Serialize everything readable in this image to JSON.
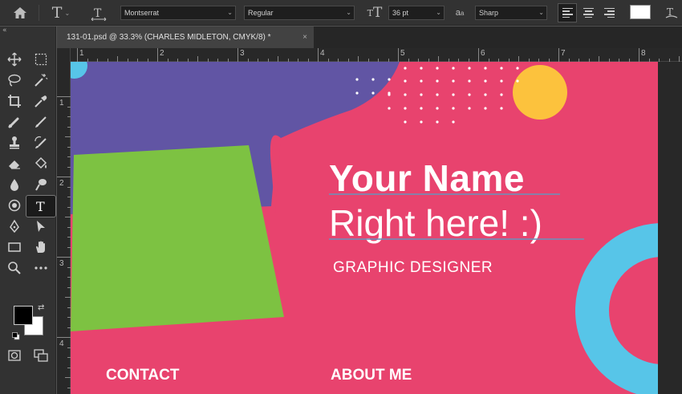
{
  "options_bar": {
    "font_family": "Montserrat",
    "font_style": "Regular",
    "font_size": "36 pt",
    "aa_label": "a",
    "antialias": "Sharp",
    "text_color": "#ffffff"
  },
  "document": {
    "tab_title": "131-01.psd @ 33.3% (CHARLES MIDLETON, CMYK/8) *",
    "close_glyph": "×"
  },
  "ruler": {
    "h_labels": [
      "1",
      "2",
      "3",
      "4",
      "5",
      "6",
      "7",
      "8"
    ],
    "v_labels": [
      "1",
      "2",
      "3",
      "4"
    ]
  },
  "canvas": {
    "name": "Your Name",
    "subtitle": "Right here! :)",
    "role": "GRAPHIC DESIGNER",
    "contact": "CONTACT",
    "about": "ABOUT ME",
    "colors": {
      "pink": "#e8436e",
      "purple": "#6155a4",
      "green": "#7dc242",
      "yellow": "#fcc23d",
      "cyan": "#57c5e8"
    }
  },
  "tools": {
    "foreground": "#000000",
    "background": "#ffffff"
  }
}
